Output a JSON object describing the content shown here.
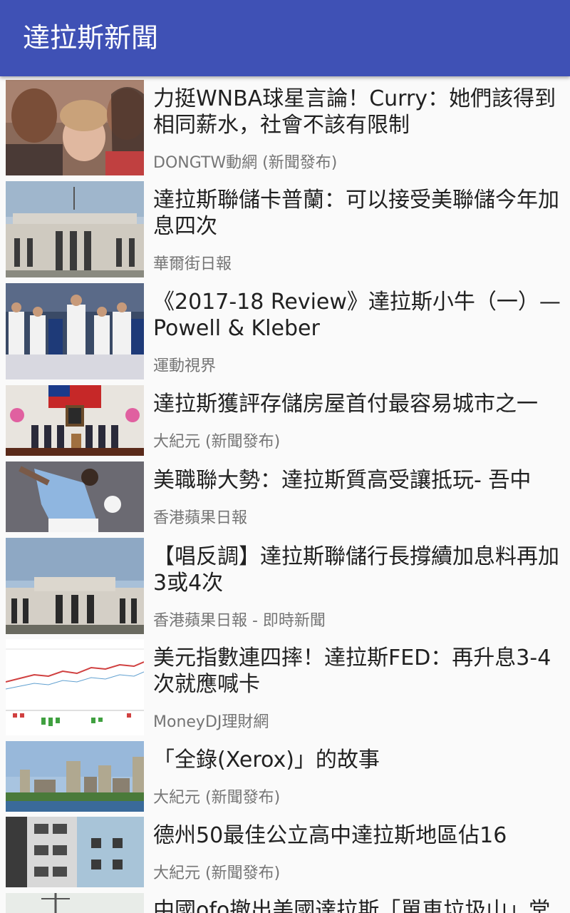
{
  "appbar": {
    "title": "達拉斯新聞",
    "color": "#3f51b5"
  },
  "articles": [
    {
      "headline": "力挺WNBA球星言論！Curry：她們該得到相同薪水，社會不該有限制",
      "source": "DONGTW動網 (新聞發布)",
      "image": "family-photo-image"
    },
    {
      "headline": "達拉斯聯儲卡普蘭：可以接受美聯儲今年加息四次",
      "source": "華爾街日報",
      "image": "federal-reserve-building-image"
    },
    {
      "headline": "《2017-18 Review》達拉斯小牛（一）— Powell & Kleber",
      "source": "運動視界",
      "image": "basketball-team-image"
    },
    {
      "headline": "達拉斯獲評存儲房屋首付最容易城市之一",
      "source": "大紀元 (新聞發布)",
      "image": "ceremony-stage-image"
    },
    {
      "headline": "美職聯大勢：達拉斯質高受讓抵玩- 吾中",
      "source": "香港蘋果日報",
      "image": "soccer-player-image"
    },
    {
      "headline": "【唱反調】達拉斯聯儲行長撐續加息料再加3或4次",
      "source": "香港蘋果日報 - 即時新聞",
      "image": "federal-reserve-building-image"
    },
    {
      "headline": "美元指數連四摔！達拉斯FED：再升息3-4次就應喊卡",
      "source": "MoneyDJ理財網",
      "image": "stock-chart-image"
    },
    {
      "headline": "「全錄(Xerox)」的故事",
      "source": "大紀元 (新聞發布)",
      "image": "city-skyline-image"
    },
    {
      "headline": "德州50最佳公立高中達拉斯地區佔16",
      "source": "大紀元 (新聞發布)",
      "image": "building-facade-image"
    },
    {
      "headline": "中國ofo撤出美國達拉斯「單車垃圾山」堂",
      "source": "",
      "image": "street-scene-image"
    }
  ]
}
